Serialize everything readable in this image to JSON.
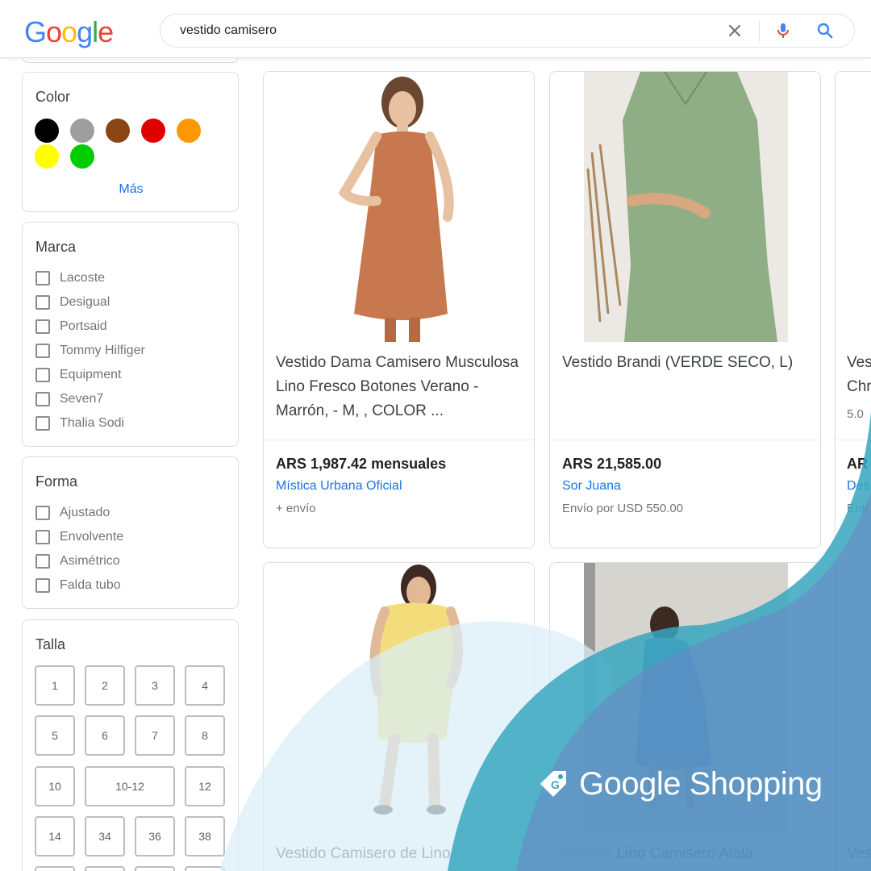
{
  "header": {
    "logo_letters": [
      "G",
      "o",
      "o",
      "g",
      "l",
      "e"
    ],
    "search_value": "vestido camisero"
  },
  "filters": {
    "color": {
      "title": "Color",
      "swatches": [
        "#000000",
        "#9e9e9e",
        "#8b4513",
        "#e00000",
        "#ff9800",
        "#ffff00",
        "#00cc00"
      ],
      "more_label": "Más"
    },
    "brand": {
      "title": "Marca",
      "items": [
        "Lacoste",
        "Desigual",
        "Portsaid",
        "Tommy Hilfiger",
        "Equipment",
        "Seven7",
        "Thalia Sodi"
      ]
    },
    "shape": {
      "title": "Forma",
      "items": [
        "Ajustado",
        "Envolvente",
        "Asimétrico",
        "Falda tubo"
      ]
    },
    "size": {
      "title": "Talla",
      "items": [
        "1",
        "2",
        "3",
        "4",
        "5",
        "6",
        "7",
        "8",
        "10",
        "10-12",
        "12",
        "14",
        "34",
        "36",
        "38"
      ]
    }
  },
  "products": [
    {
      "title": "Vestido Dama Camisero Musculosa Lino Fresco Botones Verano - Marrón, - M, , COLOR ...",
      "price": "ARS 1,987.42 mensuales",
      "merchant": "Mística Urbana Oficial",
      "shipping": "+ envío",
      "image_color": "#c8784e"
    },
    {
      "title": "Vestido Brandi (VERDE SECO, L)",
      "price": "ARS 21,585.00",
      "merchant": "Sor Juana",
      "shipping": "Envío por USD 550.00",
      "image_color": "#8fae85"
    },
    {
      "title_line1": "Ves",
      "title_line2": "Chr",
      "rating": "5.0",
      "price": "AR",
      "merchant": "Des",
      "shipping": "Entr"
    },
    {
      "title": "Vestido Camisero de Lino",
      "image_color": "#f2dd7a"
    },
    {
      "title": "Vestido Lino Camisero Alalá.",
      "image_color": "#5c84b8"
    },
    {
      "title": "Ves"
    }
  ],
  "branding": {
    "text": "Google Shopping",
    "tag_letter": "G"
  },
  "colors": {
    "overlay_light": "#d9eef6",
    "overlay_teal": "#37a6c0",
    "overlay_blue": "#6d84c4",
    "link_blue": "#1a73e8"
  }
}
